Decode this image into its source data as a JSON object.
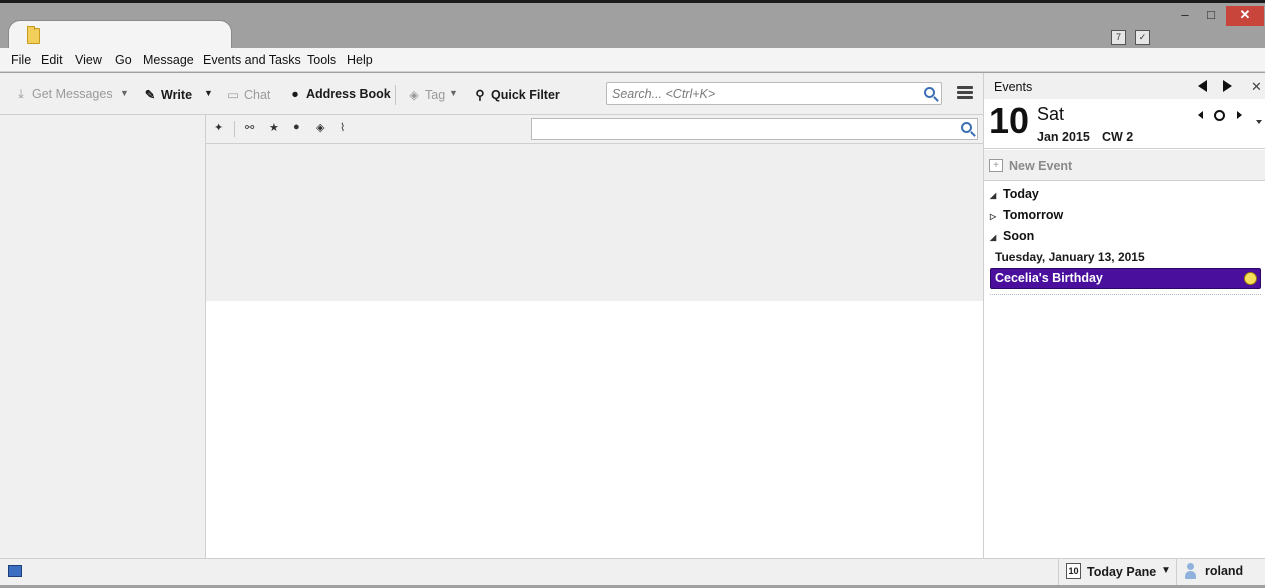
{
  "window": {
    "minimize_glyph": "–",
    "maximize_glyph": "□",
    "close_glyph": "✕"
  },
  "menubar": {
    "items": [
      {
        "label": "File"
      },
      {
        "label": "Edit"
      },
      {
        "label": "View"
      },
      {
        "label": "Go"
      },
      {
        "label": "Message"
      },
      {
        "label": "Events and Tasks"
      },
      {
        "label": "Tools"
      },
      {
        "label": "Help"
      }
    ]
  },
  "toolbar": {
    "get_messages": "Get Messages",
    "write": "Write",
    "chat": "Chat",
    "address_book": "Address Book",
    "tag": "Tag",
    "quick_filter": "Quick Filter",
    "search_placeholder": "Search... <Ctrl+K>"
  },
  "quick_filter_bar": {
    "filter_value": ""
  },
  "today_pane": {
    "title": "Events",
    "day_number": "10",
    "day_name": "Sat",
    "month_year": "Jan 2015",
    "calendar_week": "CW 2",
    "new_event": "New Event",
    "sections": [
      {
        "label": "Today",
        "expanded": true
      },
      {
        "label": "Tomorrow",
        "expanded": false
      },
      {
        "label": "Soon",
        "expanded": true
      }
    ],
    "event_date": "Tuesday, January 13, 2015",
    "event_title": "Cecelia's Birthday",
    "event_color": "#4b0f9e"
  },
  "statusbar": {
    "today_pane_label": "Today Pane",
    "today_pane_day": "10",
    "user": "roland"
  },
  "icons": {
    "tab": "folder-icon",
    "get_messages": "download-icon",
    "write": "pencil-icon",
    "chat": "chat-bubble-icon",
    "address_book": "person-icon",
    "tag": "tag-icon",
    "quick_filter": "magnifier-icon"
  }
}
